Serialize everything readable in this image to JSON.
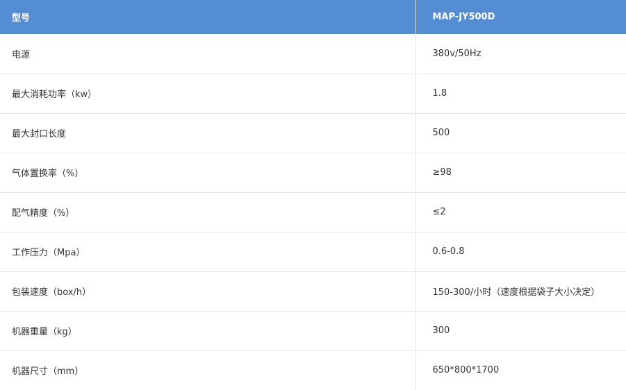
{
  "table": {
    "header": {
      "label": "型号",
      "value": "MAP-JY500D"
    },
    "rows": [
      {
        "label": "电源",
        "value": "380v/50Hz"
      },
      {
        "label": "最大消耗功率（kw）",
        "value": "1.8"
      },
      {
        "label": "最大封口长度",
        "value": "500"
      },
      {
        "label": "气体置换率（%）",
        "value": "≥98"
      },
      {
        "label": "配气精度（%）",
        "value": "≤2"
      },
      {
        "label": "工作压力（Mpa）",
        "value": "0.6-0.8"
      },
      {
        "label": "包装速度（box/h）",
        "value": "150-300/小时（速度根据袋子大小决定）"
      },
      {
        "label": "机器重量（kg）",
        "value": "300"
      },
      {
        "label": "机器尺寸（mm）",
        "value": "650*800*1700"
      }
    ]
  },
  "colors": {
    "header_bg": "#548dd4",
    "header_text": "#ffffff",
    "body_text": "#333333",
    "row_border": "#e5e5e5"
  }
}
